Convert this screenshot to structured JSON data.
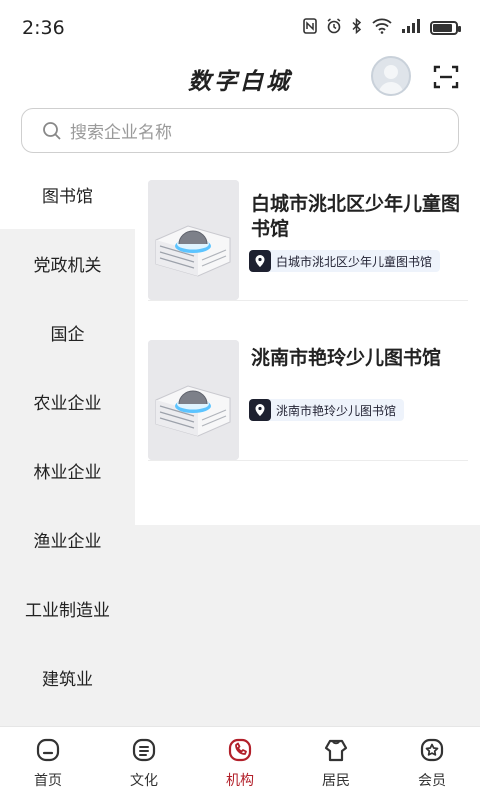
{
  "status_bar": {
    "time": "2:36",
    "icons": [
      "nfc-icon",
      "alarm-icon",
      "bluetooth-icon",
      "wifi-icon",
      "signal-icon",
      "battery-icon"
    ]
  },
  "header": {
    "title": "数字白城",
    "avatar_icon": "avatar",
    "scan_icon": "scan-icon"
  },
  "search": {
    "placeholder": "搜索企业名称"
  },
  "categories": [
    {
      "label": "图书馆",
      "active": true
    },
    {
      "label": "党政机关"
    },
    {
      "label": "国企"
    },
    {
      "label": "农业企业"
    },
    {
      "label": "林业企业"
    },
    {
      "label": "渔业企业"
    },
    {
      "label": "工业制造业"
    },
    {
      "label": "建筑业"
    }
  ],
  "organizations": [
    {
      "name": "白城市洮北区少年儿童图书馆",
      "tag": "白城市洮北区少年儿童图书馆"
    },
    {
      "name": "洮南市艳玲少儿图书馆",
      "tag": "洮南市艳玲少儿图书馆"
    }
  ],
  "tabs": [
    {
      "label": "首页",
      "icon": "home-icon"
    },
    {
      "label": "文化",
      "icon": "culture-icon"
    },
    {
      "label": "机构",
      "icon": "institution-icon",
      "active": true
    },
    {
      "label": "居民",
      "icon": "residents-icon"
    },
    {
      "label": "会员",
      "icon": "member-icon"
    }
  ],
  "colors": {
    "accent": "#b2202a",
    "sidebar_bg": "#f1f1f1",
    "tag_bg": "#eef3fb",
    "pin_bg": "#1e2130"
  }
}
